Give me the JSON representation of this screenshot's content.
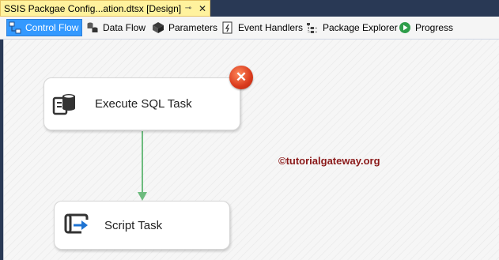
{
  "document_tab": {
    "title": "SSIS Packgae Config...ation.dtsx [Design]",
    "pin_glyph": "⊸",
    "close_glyph": "✕"
  },
  "toolbar": {
    "tabs": [
      {
        "label": "Control Flow",
        "icon": "control-flow-icon",
        "active": true
      },
      {
        "label": "Data Flow",
        "icon": "data-flow-icon",
        "active": false
      },
      {
        "label": "Parameters",
        "icon": "parameters-icon",
        "active": false
      },
      {
        "label": "Event Handlers",
        "icon": "event-handlers-icon",
        "active": false
      },
      {
        "label": "Package Explorer",
        "icon": "package-explorer-icon",
        "active": false
      },
      {
        "label": "Progress",
        "icon": "progress-icon",
        "active": false
      }
    ]
  },
  "canvas": {
    "tasks": [
      {
        "label": "Execute SQL Task",
        "icon": "execute-sql-task-icon",
        "has_error": true
      },
      {
        "label": "Script Task",
        "icon": "script-task-icon",
        "has_error": false
      }
    ],
    "error_glyph": "✕",
    "watermark": "©tutorialgateway.org"
  },
  "colors": {
    "active_tab": "#3399ff",
    "tab_strip": "#293955",
    "document_tab": "#fff29d",
    "connector": "#6dbb7e",
    "error": "#d9391c",
    "watermark": "#8b1a1a"
  }
}
